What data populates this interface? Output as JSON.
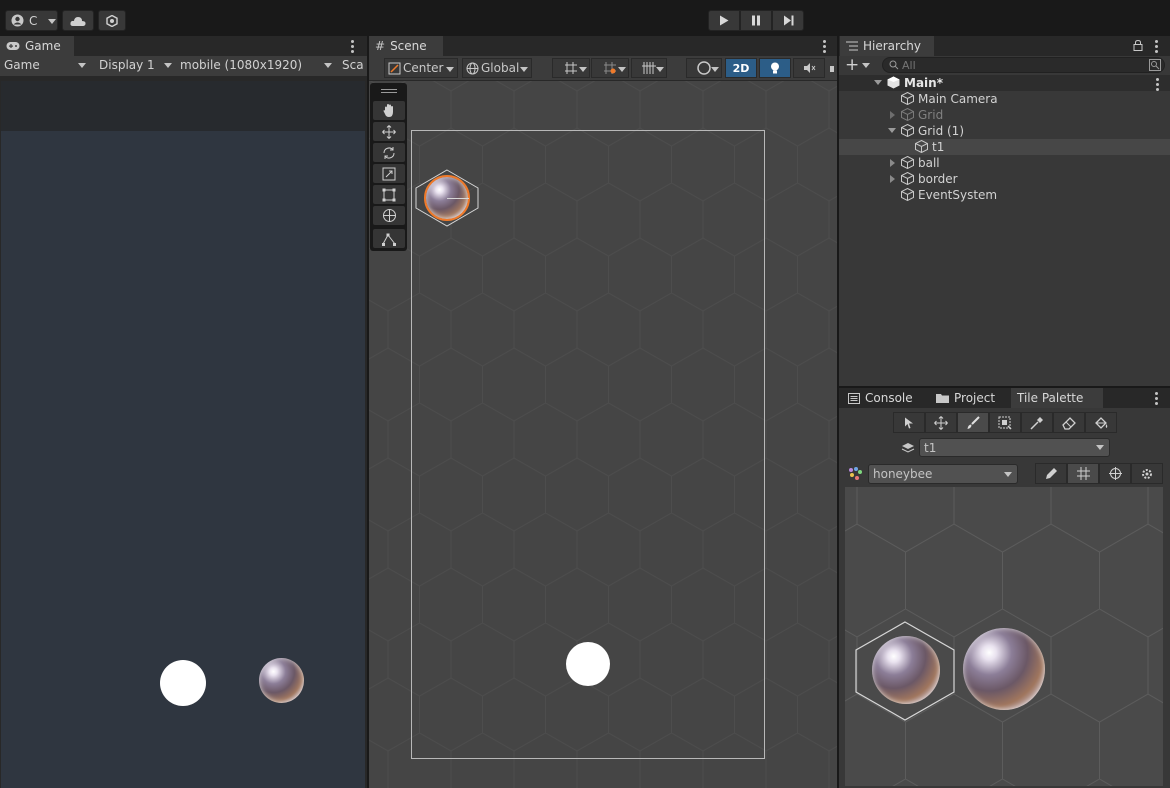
{
  "top_toolbar": {
    "account_label": "C",
    "account_icon": "account-icon",
    "cloud_icon": "cloud-icon",
    "settings_icon": "settings-icon",
    "play_icon": "play-icon",
    "pause_icon": "pause-icon",
    "step_icon": "step-icon"
  },
  "game_panel": {
    "tab_label": "Game",
    "mode_label": "Game",
    "display_label": "Display 1",
    "resolution_label": "mobile (1080x1920)",
    "scale_label": "Sca"
  },
  "scene_panel": {
    "tab_label": "Scene",
    "pivot_label": "Center",
    "space_label": "Global",
    "two_d_label": "2D",
    "tools": [
      "view-tool-icon",
      "move-tool-icon",
      "rotate-tool-icon",
      "scale-tool-icon",
      "rect-tool-icon",
      "transform-tool-icon",
      "custom-tool-icon"
    ]
  },
  "hierarchy": {
    "tab_label": "Hierarchy",
    "search_placeholder": "All",
    "items": [
      {
        "label": "Main*",
        "depth": 0
      },
      {
        "label": "Main Camera",
        "depth": 1
      },
      {
        "label": "Grid",
        "depth": 1
      },
      {
        "label": "Grid (1)",
        "depth": 1
      },
      {
        "label": "t1",
        "depth": 2
      },
      {
        "label": "ball",
        "depth": 1
      },
      {
        "label": "border",
        "depth": 1
      },
      {
        "label": "EventSystem",
        "depth": 1
      }
    ]
  },
  "bottom_tabs": {
    "console_label": "Console",
    "project_label": "Project",
    "tile_palette_label": "Tile Palette"
  },
  "tile_palette": {
    "tilemap_value": "t1",
    "palette_value": "honeybee",
    "tools": [
      "select-tool-icon",
      "move-tool-icon",
      "paint-brush-icon",
      "box-fill-icon",
      "picker-icon",
      "eraser-icon",
      "fill-bucket-icon"
    ],
    "edit_tools": [
      "edit-pencil-icon",
      "grid-icon",
      "gizmo-icon",
      "settings-gear-icon"
    ]
  },
  "colors": {
    "accent_blue": "#2c5d87",
    "selection_orange": "#f07a2a",
    "game_bg": "#2f3640",
    "scene_bg": "#454545"
  }
}
